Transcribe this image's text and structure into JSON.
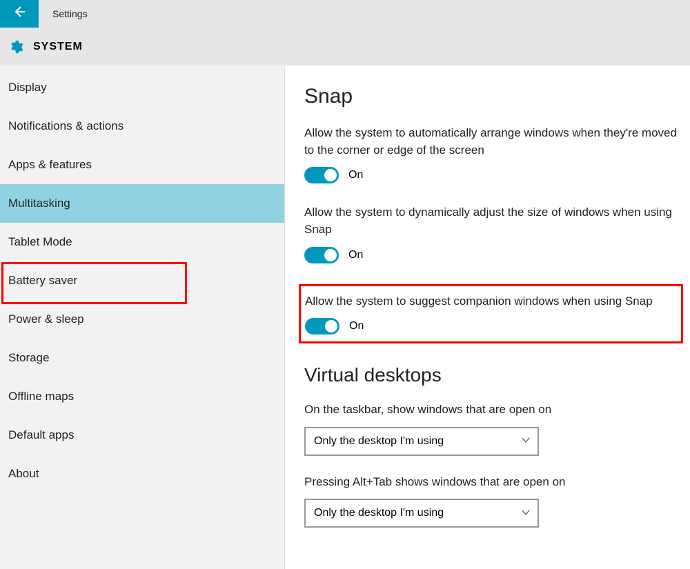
{
  "titlebar": {
    "title": "Settings"
  },
  "header": {
    "label": "SYSTEM"
  },
  "sidebar": {
    "items": [
      {
        "label": "Display"
      },
      {
        "label": "Notifications & actions"
      },
      {
        "label": "Apps & features"
      },
      {
        "label": "Multitasking",
        "selected": true
      },
      {
        "label": "Tablet Mode"
      },
      {
        "label": "Battery saver"
      },
      {
        "label": "Power & sleep"
      },
      {
        "label": "Storage"
      },
      {
        "label": "Offline maps"
      },
      {
        "label": "Default apps"
      },
      {
        "label": "About"
      }
    ]
  },
  "content": {
    "snap": {
      "heading": "Snap",
      "settings": [
        {
          "label": "Allow the system to automatically arrange windows when they're moved to the corner or edge of the screen",
          "state": "On"
        },
        {
          "label": "Allow the system to dynamically adjust the size of windows when using Snap",
          "state": "On"
        },
        {
          "label": "Allow the system to suggest companion windows when using Snap",
          "state": "On",
          "highlighted": true
        }
      ]
    },
    "virtual_desktops": {
      "heading": "Virtual desktops",
      "settings": [
        {
          "label": "On the taskbar, show windows that are open on",
          "value": "Only the desktop I'm using"
        },
        {
          "label": "Pressing Alt+Tab shows windows that are open on",
          "value": "Only the desktop I'm using"
        }
      ]
    }
  }
}
